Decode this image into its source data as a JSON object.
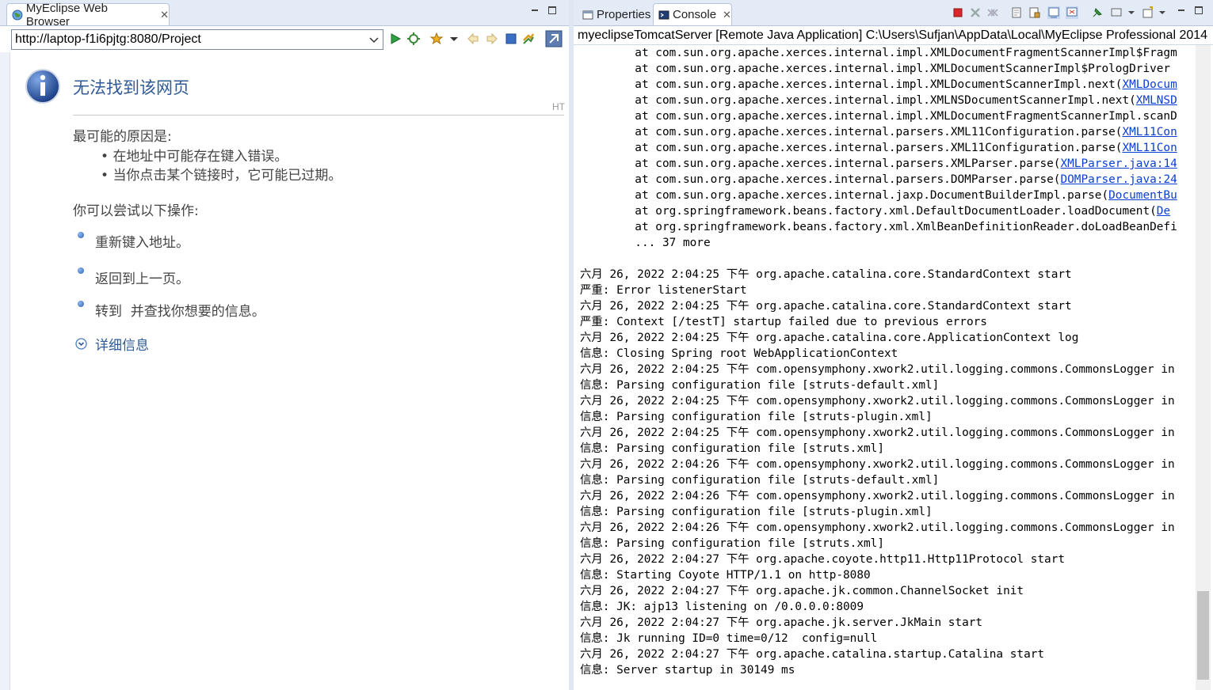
{
  "browser": {
    "tab_title": "MyEclipse Web Browser",
    "url": "http://laptop-f1i6pjtg:8080/Project",
    "error": {
      "title": "无法找到该网页",
      "corner_text": "HT",
      "reasons_heading": "最可能的原因是:",
      "reasons": [
        "在地址中可能存在键入错误。",
        "当你点击某个链接时，它可能已过期。"
      ],
      "actions_heading": "你可以尝试以下操作:",
      "actions": [
        "重新键入地址。",
        "返回到上一页。",
        "转到  并查找你想要的信息。"
      ],
      "details_label": "详细信息"
    }
  },
  "views": {
    "properties_tab": "Properties",
    "console_tab": "Console"
  },
  "console": {
    "header": "myeclipseTomcatServer [Remote Java Application] C:\\Users\\Sufjan\\AppData\\Local\\MyEclipse Professional 2014",
    "stack": [
      {
        "t": "        at com.sun.org.apache.xerces.internal.impl.XMLDocumentFragmentScannerImpl$Fragm",
        "link": ""
      },
      {
        "t": "        at com.sun.org.apache.xerces.internal.impl.XMLDocumentScannerImpl$PrologDriver",
        "link": ""
      },
      {
        "t": "        at com.sun.org.apache.xerces.internal.impl.XMLDocumentScannerImpl.next(",
        "link": "XMLDocum"
      },
      {
        "t": "        at com.sun.org.apache.xerces.internal.impl.XMLNSDocumentScannerImpl.next(",
        "link": "XMLNSD"
      },
      {
        "t": "        at com.sun.org.apache.xerces.internal.impl.XMLDocumentFragmentScannerImpl.scanD",
        "link": ""
      },
      {
        "t": "        at com.sun.org.apache.xerces.internal.parsers.XML11Configuration.parse(",
        "link": "XML11Con"
      },
      {
        "t": "        at com.sun.org.apache.xerces.internal.parsers.XML11Configuration.parse(",
        "link": "XML11Con"
      },
      {
        "t": "        at com.sun.org.apache.xerces.internal.parsers.XMLParser.parse(",
        "link": "XMLParser.java:14"
      },
      {
        "t": "        at com.sun.org.apache.xerces.internal.parsers.DOMParser.parse(",
        "link": "DOMParser.java:24"
      },
      {
        "t": "        at com.sun.org.apache.xerces.internal.jaxp.DocumentBuilderImpl.parse(",
        "link": "DocumentBu"
      },
      {
        "t": "        at org.springframework.beans.factory.xml.DefaultDocumentLoader.loadDocument(",
        "link": "De"
      },
      {
        "t": "        at org.springframework.beans.factory.xml.XmlBeanDefinitionReader.doLoadBeanDefi",
        "link": ""
      },
      {
        "t": "        ... 37 more",
        "link": ""
      }
    ],
    "log": [
      "六月 26, 2022 2:04:25 下午 org.apache.catalina.core.StandardContext start",
      "严重: Error listenerStart",
      "六月 26, 2022 2:04:25 下午 org.apache.catalina.core.StandardContext start",
      "严重: Context [/testT] startup failed due to previous errors",
      "六月 26, 2022 2:04:25 下午 org.apache.catalina.core.ApplicationContext log",
      "信息: Closing Spring root WebApplicationContext",
      "六月 26, 2022 2:04:25 下午 com.opensymphony.xwork2.util.logging.commons.CommonsLogger in",
      "信息: Parsing configuration file [struts-default.xml]",
      "六月 26, 2022 2:04:25 下午 com.opensymphony.xwork2.util.logging.commons.CommonsLogger in",
      "信息: Parsing configuration file [struts-plugin.xml]",
      "六月 26, 2022 2:04:25 下午 com.opensymphony.xwork2.util.logging.commons.CommonsLogger in",
      "信息: Parsing configuration file [struts.xml]",
      "六月 26, 2022 2:04:26 下午 com.opensymphony.xwork2.util.logging.commons.CommonsLogger in",
      "信息: Parsing configuration file [struts-default.xml]",
      "六月 26, 2022 2:04:26 下午 com.opensymphony.xwork2.util.logging.commons.CommonsLogger in",
      "信息: Parsing configuration file [struts-plugin.xml]",
      "六月 26, 2022 2:04:26 下午 com.opensymphony.xwork2.util.logging.commons.CommonsLogger in",
      "信息: Parsing configuration file [struts.xml]",
      "六月 26, 2022 2:04:27 下午 org.apache.coyote.http11.Http11Protocol start",
      "信息: Starting Coyote HTTP/1.1 on http-8080",
      "六月 26, 2022 2:04:27 下午 org.apache.jk.common.ChannelSocket init",
      "信息: JK: ajp13 listening on /0.0.0.0:8009",
      "六月 26, 2022 2:04:27 下午 org.apache.jk.server.JkMain start",
      "信息: Jk running ID=0 time=0/12  config=null",
      "六月 26, 2022 2:04:27 下午 org.apache.catalina.startup.Catalina start",
      "信息: Server startup in 30149 ms"
    ]
  },
  "colors": {
    "accent": "#2f5a95",
    "link": "#0b3fd1",
    "stop_red": "#d9262b"
  },
  "icons": {
    "browser_tab": "globe-icon",
    "go": "play-icon",
    "refresh": "refresh-icon",
    "favorites": "star-icon",
    "back": "back-arrow-icon",
    "forward": "forward-arrow-icon",
    "stop": "stop-icon",
    "sync": "sync-icon",
    "info": "info-icon",
    "details": "expand-circle-icon"
  }
}
